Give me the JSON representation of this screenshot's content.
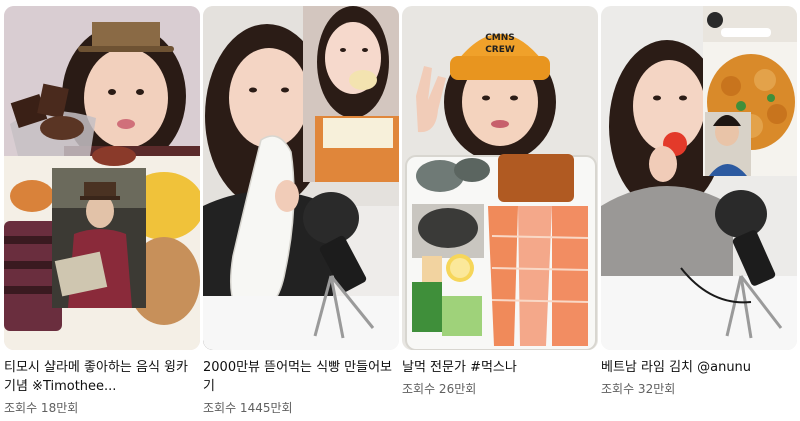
{
  "videos": [
    {
      "title": "티모시 샬라메 좋아하는 음식 윙카 기념 ※Timothee...",
      "views": "조회수 18만회",
      "thumb_icon": "chocolate-dessert-thumbnail"
    },
    {
      "title": "2000만뷰 뜯어먹는 식빵 만들어보기",
      "views": "조회수 1445만회",
      "thumb_icon": "bread-eating-thumbnail"
    },
    {
      "title": "날먹 전문가 #먹스나",
      "views": "조회수 26만회",
      "thumb_icon": "raw-seafood-thumbnail",
      "hat_text": "CMNS\nCREW"
    },
    {
      "title": "베트남 라임 김치 @anunu",
      "views": "조회수 32만회",
      "thumb_icon": "lime-kimchi-thumbnail"
    }
  ],
  "colors": {
    "title": "#0f0f0f",
    "views": "#606060",
    "background": "#ffffff"
  }
}
